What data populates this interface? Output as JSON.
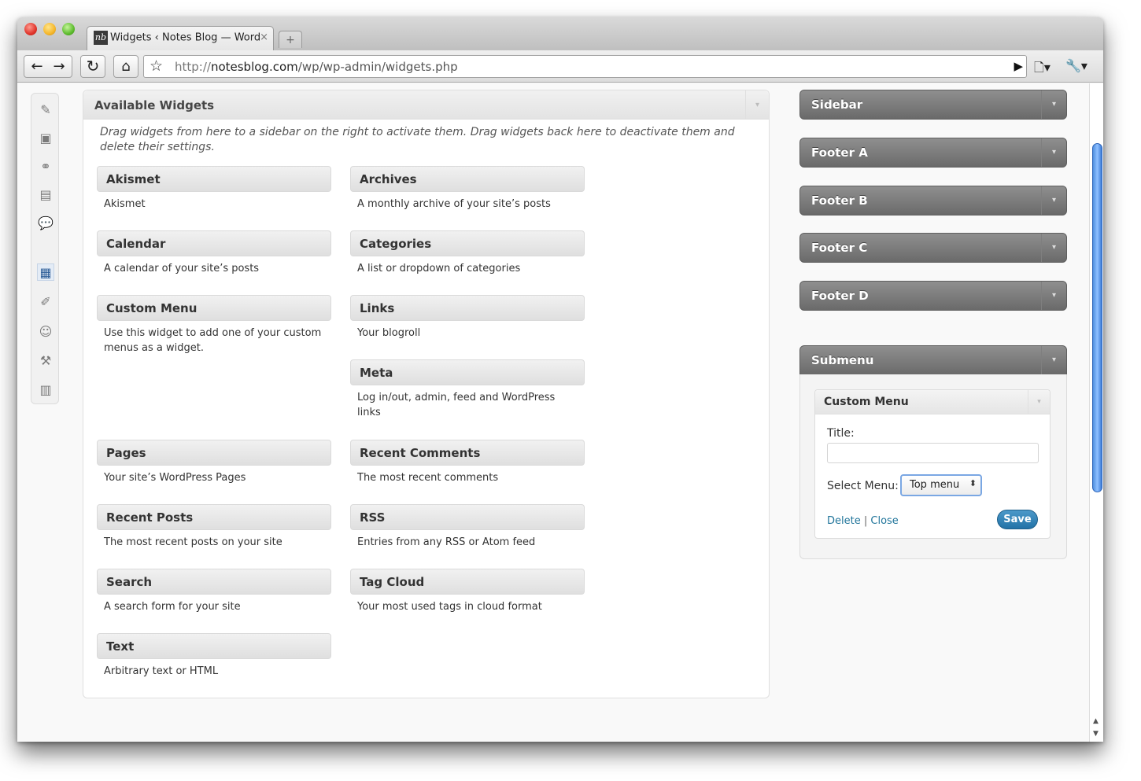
{
  "browser": {
    "tab": {
      "favicon_text": "nb",
      "title": "Widgets ‹ Notes Blog — Word",
      "close": "×"
    },
    "new_tab": "+",
    "url": {
      "scheme": "http://",
      "host": "notesblog.com",
      "path": "/wp/wp-admin/widgets.php"
    },
    "icons": {
      "back": "←",
      "forward": "→",
      "reload": "↻",
      "home": "⌂",
      "bookmark": "☆",
      "go": "▶",
      "page_menu": "🗋▾",
      "wrench_menu": "🔧▾"
    }
  },
  "admin_menu": {
    "items": [
      {
        "name": "posts",
        "glyph": "✎"
      },
      {
        "name": "media",
        "glyph": "▣"
      },
      {
        "name": "links",
        "glyph": "⚭"
      },
      {
        "name": "pages",
        "glyph": "▤"
      },
      {
        "name": "comments",
        "glyph": "💬"
      },
      {
        "name": "appearance",
        "glyph": "▦"
      },
      {
        "name": "plugins",
        "glyph": "✐"
      },
      {
        "name": "users",
        "glyph": "☺"
      },
      {
        "name": "tools",
        "glyph": "⚒"
      },
      {
        "name": "settings",
        "glyph": "▥"
      }
    ],
    "active": "appearance"
  },
  "available": {
    "title": "Available Widgets",
    "toggle": "▾",
    "description": "Drag widgets from here to a sidebar on the right to activate them. Drag widgets back here to deactivate them and delete their settings.",
    "widgets": [
      {
        "title": "Akismet",
        "desc": "Akismet"
      },
      {
        "title": "Archives",
        "desc": "A monthly archive of your site’s posts"
      },
      {
        "title": "Calendar",
        "desc": "A calendar of your site’s posts"
      },
      {
        "title": "Categories",
        "desc": "A list or dropdown of categories"
      },
      {
        "title": "Custom Menu",
        "desc": "Use this widget to add one of your custom menus as a widget."
      },
      {
        "title": "Links",
        "desc": "Your blogroll"
      },
      {
        "title": "Meta",
        "desc": "Log in/out, admin, feed and WordPress links"
      },
      {
        "title": "Pages",
        "desc": "Your site’s WordPress Pages"
      },
      {
        "title": "Recent Comments",
        "desc": "The most recent comments"
      },
      {
        "title": "Recent Posts",
        "desc": "The most recent posts on your site"
      },
      {
        "title": "RSS",
        "desc": "Entries from any RSS or Atom feed"
      },
      {
        "title": "Search",
        "desc": "A search form for your site"
      },
      {
        "title": "Tag Cloud",
        "desc": "Your most used tags in cloud format"
      },
      {
        "title": "Text",
        "desc": "Arbitrary text or HTML"
      }
    ]
  },
  "sidebars": [
    {
      "title": "Sidebar",
      "toggle": "▾"
    },
    {
      "title": "Footer A",
      "toggle": "▾"
    },
    {
      "title": "Footer B",
      "toggle": "▾"
    },
    {
      "title": "Footer C",
      "toggle": "▾"
    },
    {
      "title": "Footer D",
      "toggle": "▾"
    },
    {
      "title": "Submenu",
      "toggle": "▾"
    }
  ],
  "custom_menu_widget": {
    "title": "Custom Menu",
    "toggle": "▾",
    "title_label": "Title:",
    "title_value": "",
    "select_label": "Select Menu:",
    "select_value": "Top menu",
    "select_arrows": "⬍",
    "delete": "Delete",
    "separator": "|",
    "close": "Close",
    "save": "Save"
  },
  "colors": {
    "link": "#21759b",
    "save_button": "#2a7fb5",
    "sidebar_header": "#7a7a7a"
  }
}
